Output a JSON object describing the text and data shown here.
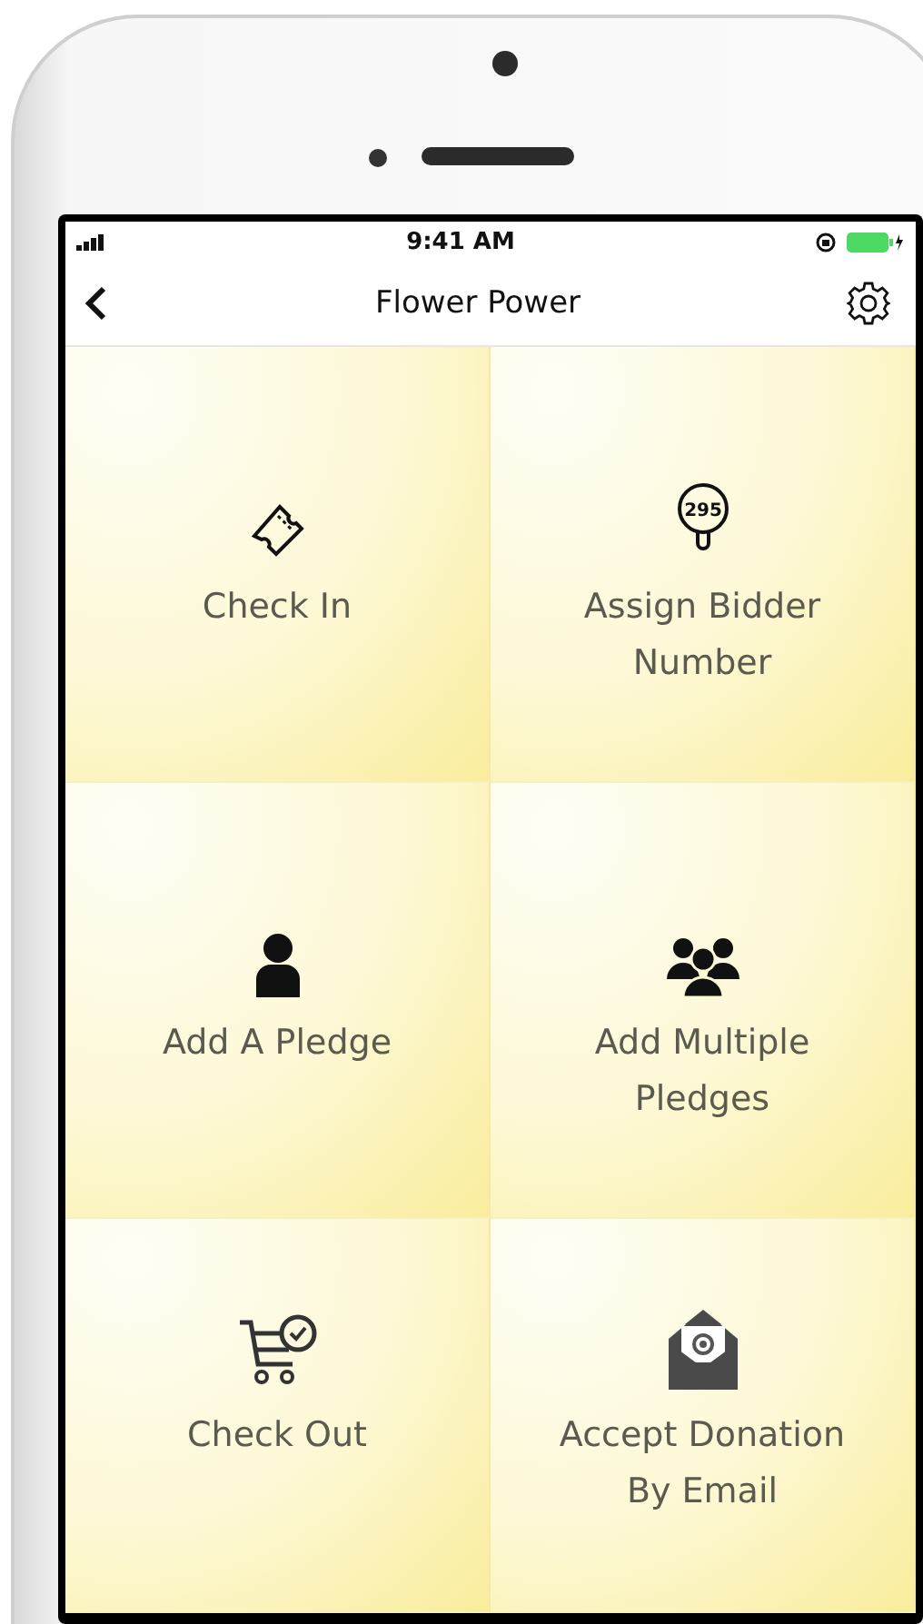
{
  "status_bar": {
    "time": "9:41 AM"
  },
  "nav_bar": {
    "title": "Flower Power"
  },
  "tile_rows": [
    {
      "tiles": [
        {
          "kind": "ticket",
          "label": "Check In"
        },
        {
          "kind": "paddle",
          "label": "Assign Bidder Number",
          "paddle_number": "295"
        }
      ]
    },
    {
      "tiles": [
        {
          "kind": "person",
          "label": "Add A Pledge"
        },
        {
          "kind": "group",
          "label": "Add Multiple Pledges"
        }
      ]
    },
    {
      "tiles": [
        {
          "kind": "cart",
          "label": "Check Out"
        },
        {
          "kind": "envelope",
          "label": "Accept Donation By Email"
        }
      ]
    }
  ]
}
